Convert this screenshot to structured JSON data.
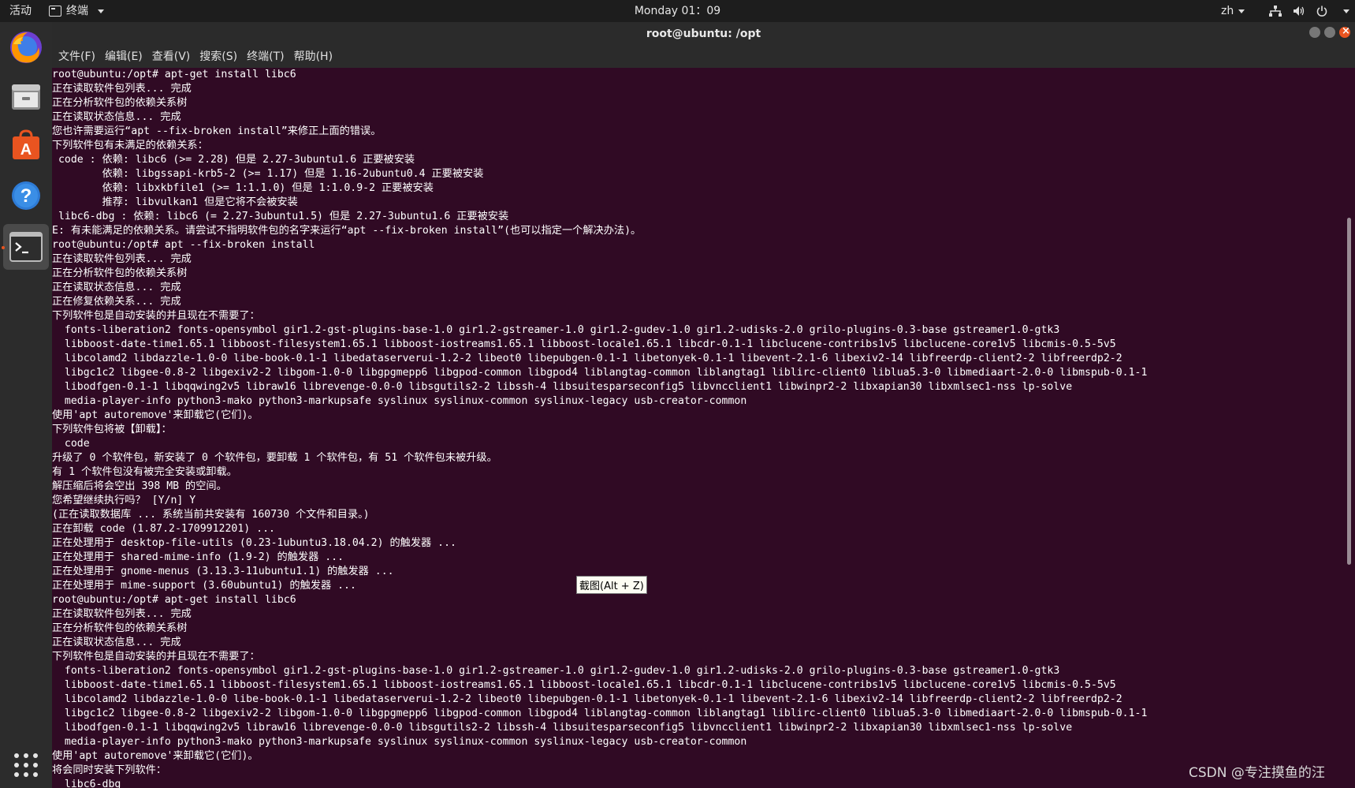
{
  "topbar": {
    "activities": "活动",
    "app_name": "终端",
    "clock": "Monday 01：09",
    "lang": "zh"
  },
  "dock": {
    "items": [
      "firefox-icon",
      "files-icon",
      "software-center-icon",
      "help-icon",
      "terminal-icon",
      "show-apps-icon"
    ]
  },
  "window": {
    "title": "root@ubuntu: /opt"
  },
  "menubar": {
    "items": [
      "文件(F)",
      "编辑(E)",
      "查看(V)",
      "搜索(S)",
      "终端(T)",
      "帮助(H)"
    ]
  },
  "terminal": {
    "lines": [
      "root@ubuntu:/opt# apt-get install libc6",
      "正在读取软件包列表... 完成",
      "正在分析软件包的依赖关系树",
      "正在读取状态信息... 完成",
      "您也许需要运行“apt --fix-broken install”来修正上面的错误。",
      "下列软件包有未满足的依赖关系：",
      " code : 依赖: libc6 (>= 2.28) 但是 2.27-3ubuntu1.6 正要被安装",
      "        依赖: libgssapi-krb5-2 (>= 1.17) 但是 1.16-2ubuntu0.4 正要被安装",
      "        依赖: libxkbfile1 (>= 1:1.1.0) 但是 1:1.0.9-2 正要被安装",
      "        推荐: libvulkan1 但是它将不会被安装",
      " libc6-dbg : 依赖: libc6 (= 2.27-3ubuntu1.5) 但是 2.27-3ubuntu1.6 正要被安装",
      "E: 有未能满足的依赖关系。请尝试不指明软件包的名字来运行“apt --fix-broken install”(也可以指定一个解决办法)。",
      "root@ubuntu:/opt# apt --fix-broken install",
      "正在读取软件包列表... 完成",
      "正在分析软件包的依赖关系树",
      "正在读取状态信息... 完成",
      "正在修复依赖关系... 完成",
      "下列软件包是自动安装的并且现在不需要了：",
      "  fonts-liberation2 fonts-opensymbol gir1.2-gst-plugins-base-1.0 gir1.2-gstreamer-1.0 gir1.2-gudev-1.0 gir1.2-udisks-2.0 grilo-plugins-0.3-base gstreamer1.0-gtk3",
      "  libboost-date-time1.65.1 libboost-filesystem1.65.1 libboost-iostreams1.65.1 libboost-locale1.65.1 libcdr-0.1-1 libclucene-contribs1v5 libclucene-core1v5 libcmis-0.5-5v5",
      "  libcolamd2 libdazzle-1.0-0 libe-book-0.1-1 libedataserverui-1.2-2 libeot0 libepubgen-0.1-1 libetonyek-0.1-1 libevent-2.1-6 libexiv2-14 libfreerdp-client2-2 libfreerdp2-2",
      "  libgc1c2 libgee-0.8-2 libgexiv2-2 libgom-1.0-0 libgpgmepp6 libgpod-common libgpod4 liblangtag-common liblangtag1 liblirc-client0 liblua5.3-0 libmediaart-2.0-0 libmspub-0.1-1",
      "  libodfgen-0.1-1 libqqwing2v5 libraw16 librevenge-0.0-0 libsgutils2-2 libssh-4 libsuitesparseconfig5 libvncclient1 libwinpr2-2 libxapian30 libxmlsec1-nss lp-solve",
      "  media-player-info python3-mako python3-markupsafe syslinux syslinux-common syslinux-legacy usb-creator-common",
      "使用'apt autoremove'来卸载它(它们)。",
      "下列软件包将被【卸载】：",
      "  code",
      "升级了 0 个软件包，新安装了 0 个软件包，要卸载 1 个软件包，有 51 个软件包未被升级。",
      "有 1 个软件包没有被完全安装或卸载。",
      "解压缩后将会空出 398 MB 的空间。",
      "您希望继续执行吗？ [Y/n] Y",
      "(正在读取数据库 ... 系统当前共安装有 160730 个文件和目录。)",
      "正在卸载 code (1.87.2-1709912201) ...",
      "正在处理用于 desktop-file-utils (0.23-1ubuntu3.18.04.2) 的触发器 ...",
      "正在处理用于 shared-mime-info (1.9-2) 的触发器 ...",
      "正在处理用于 gnome-menus (3.13.3-11ubuntu1.1) 的触发器 ...",
      "正在处理用于 mime-support (3.60ubuntu1) 的触发器 ...",
      "root@ubuntu:/opt# apt-get install libc6",
      "正在读取软件包列表... 完成",
      "正在分析软件包的依赖关系树",
      "正在读取状态信息... 完成",
      "下列软件包是自动安装的并且现在不需要了：",
      "  fonts-liberation2 fonts-opensymbol gir1.2-gst-plugins-base-1.0 gir1.2-gstreamer-1.0 gir1.2-gudev-1.0 gir1.2-udisks-2.0 grilo-plugins-0.3-base gstreamer1.0-gtk3",
      "  libboost-date-time1.65.1 libboost-filesystem1.65.1 libboost-iostreams1.65.1 libboost-locale1.65.1 libcdr-0.1-1 libclucene-contribs1v5 libclucene-core1v5 libcmis-0.5-5v5",
      "  libcolamd2 libdazzle-1.0-0 libe-book-0.1-1 libedataserverui-1.2-2 libeot0 libepubgen-0.1-1 libetonyek-0.1-1 libevent-2.1-6 libexiv2-14 libfreerdp-client2-2 libfreerdp2-2",
      "  libgc1c2 libgee-0.8-2 libgexiv2-2 libgom-1.0-0 libgpgmepp6 libgpod-common libgpod4 liblangtag-common liblangtag1 liblirc-client0 liblua5.3-0 libmediaart-2.0-0 libmspub-0.1-1",
      "  libodfgen-0.1-1 libqqwing2v5 libraw16 librevenge-0.0-0 libsgutils2-2 libssh-4 libsuitesparseconfig5 libvncclient1 libwinpr2-2 libxapian30 libxmlsec1-nss lp-solve",
      "  media-player-info python3-mako python3-markupsafe syslinux syslinux-common syslinux-legacy usb-creator-common",
      "使用'apt autoremove'来卸载它(它们)。",
      "将会同时安装下列软件：",
      "  libc6-dbg"
    ]
  },
  "tooltip": "截图(Alt + Z)",
  "watermark": "CSDN @专注摸鱼的汪"
}
